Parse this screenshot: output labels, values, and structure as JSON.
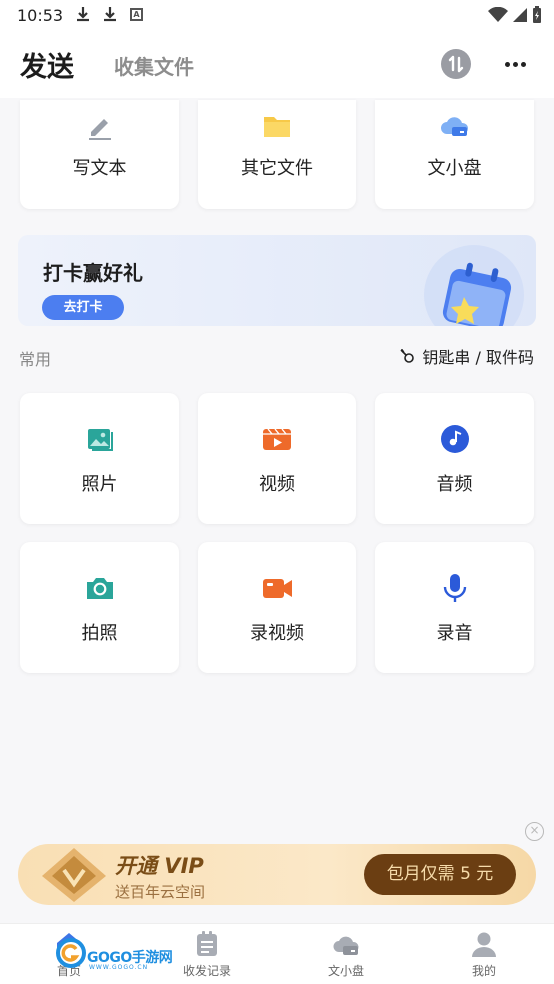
{
  "status": {
    "time": "10:53"
  },
  "header": {
    "active_tab": "发送",
    "other_tab": "收集文件"
  },
  "top_cards": [
    {
      "label": "写文本",
      "icon": "pencil-icon"
    },
    {
      "label": "其它文件",
      "icon": "folder-icon"
    },
    {
      "label": "文小盘",
      "icon": "cloud-disk-icon"
    }
  ],
  "banner": {
    "title": "打卡赢好礼",
    "button": "去打卡"
  },
  "common": {
    "label": "常用",
    "keychain": "钥匙串 / 取件码"
  },
  "grid": [
    {
      "label": "照片",
      "icon": "photo-icon"
    },
    {
      "label": "视频",
      "icon": "video-icon"
    },
    {
      "label": "音频",
      "icon": "audio-icon"
    },
    {
      "label": "拍照",
      "icon": "camera-icon"
    },
    {
      "label": "录视频",
      "icon": "record-video-icon"
    },
    {
      "label": "录音",
      "icon": "microphone-icon"
    }
  ],
  "vip": {
    "title": "开通 VIP",
    "subtitle": "送百年云空间",
    "button": "包月仅需 5 元",
    "close": "×"
  },
  "nav": [
    {
      "label": "首页",
      "icon": "home-icon"
    },
    {
      "label": "收发记录",
      "icon": "records-icon"
    },
    {
      "label": "文小盘",
      "icon": "cloud-disk-icon"
    },
    {
      "label": "我的",
      "icon": "profile-icon"
    }
  ],
  "watermark": {
    "text": "GOGO手游网",
    "url": "WWW.GOGO.CN"
  },
  "colors": {
    "accent": "#4c7ef0",
    "teal": "#2aa59a",
    "orange": "#ee6a2a",
    "blue": "#2b5ad9",
    "vip_brown": "#6b3e12"
  }
}
